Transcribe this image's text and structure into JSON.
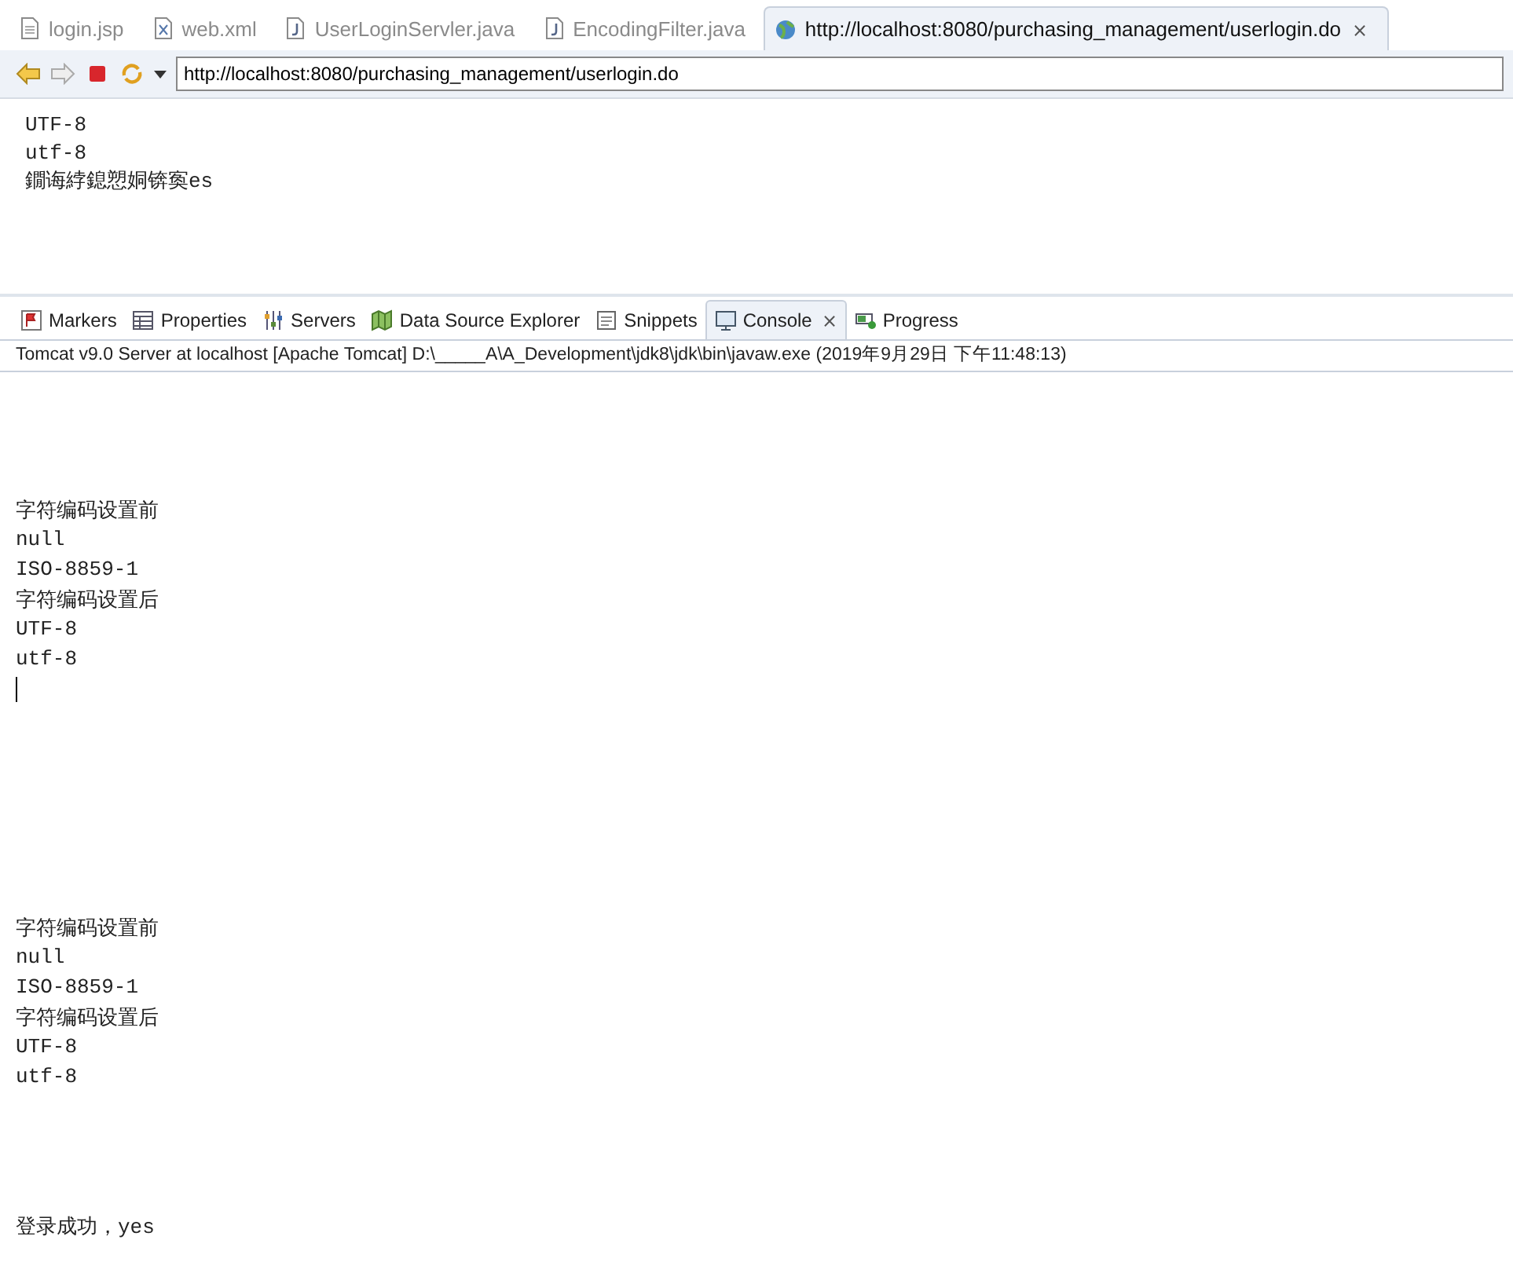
{
  "editor_tabs": [
    {
      "label": "login.jsp",
      "kind": "file",
      "selected": false
    },
    {
      "label": "web.xml",
      "kind": "xml",
      "selected": false
    },
    {
      "label": "UserLoginServler.java",
      "kind": "java",
      "selected": false
    },
    {
      "label": "EncodingFilter.java",
      "kind": "java",
      "selected": false
    },
    {
      "label": "http://localhost:8080/purchasing_management/userlogin.do",
      "kind": "web",
      "selected": true,
      "close": "⨯"
    }
  ],
  "browser": {
    "url": "http://localhost:8080/purchasing_management/userlogin.do",
    "lines": [
      "UTF-8",
      "utf-8",
      "鐗诲綍鎴愬姛锛寏es"
    ]
  },
  "view_tabs": [
    {
      "label": "Markers",
      "kind": "markers",
      "selected": false
    },
    {
      "label": "Properties",
      "kind": "properties",
      "selected": false
    },
    {
      "label": "Servers",
      "kind": "servers",
      "selected": false
    },
    {
      "label": "Data Source Explorer",
      "kind": "datasource",
      "selected": false
    },
    {
      "label": "Snippets",
      "kind": "snippets",
      "selected": false
    },
    {
      "label": "Console",
      "kind": "console",
      "selected": true,
      "close": "⨯"
    },
    {
      "label": "Progress",
      "kind": "progress",
      "selected": false
    }
  ],
  "console": {
    "header": "Tomcat v9.0 Server at localhost [Apache Tomcat] D:\\_____A\\A_Development\\jdk8\\jdk\\bin\\javaw.exe (2019年9月29日 下午11:48:13)",
    "lines": [
      {
        "kind": "blank"
      },
      {
        "kind": "blank"
      },
      {
        "kind": "blank"
      },
      {
        "kind": "blank"
      },
      {
        "kind": "text",
        "text": "字符编码设置前"
      },
      {
        "kind": "text",
        "text": "null"
      },
      {
        "kind": "text",
        "text": "ISO-8859-1"
      },
      {
        "kind": "text",
        "text": "字符编码设置后"
      },
      {
        "kind": "text",
        "text": "UTF-8"
      },
      {
        "kind": "text",
        "text": "utf-8"
      },
      {
        "kind": "cursor"
      },
      {
        "kind": "blank"
      },
      {
        "kind": "blank"
      },
      {
        "kind": "blank"
      },
      {
        "kind": "blank"
      },
      {
        "kind": "blank"
      },
      {
        "kind": "blank"
      },
      {
        "kind": "blank"
      },
      {
        "kind": "text",
        "text": "字符编码设置前"
      },
      {
        "kind": "text",
        "text": "null"
      },
      {
        "kind": "text",
        "text": "ISO-8859-1"
      },
      {
        "kind": "text",
        "text": "字符编码设置后"
      },
      {
        "kind": "text",
        "text": "UTF-8"
      },
      {
        "kind": "text",
        "text": "utf-8"
      },
      {
        "kind": "blank"
      },
      {
        "kind": "blank"
      },
      {
        "kind": "blank"
      },
      {
        "kind": "blank"
      },
      {
        "kind": "text",
        "text": "登录成功，yes"
      }
    ]
  }
}
